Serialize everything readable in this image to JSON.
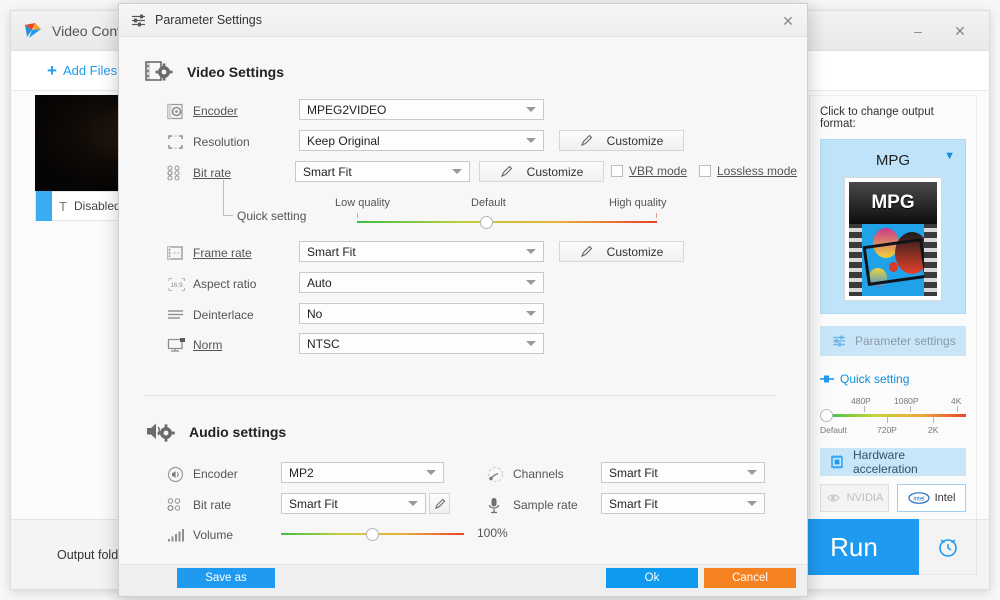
{
  "background_app": {
    "title": "Video Conve",
    "logo_icon": "app-logo-icon",
    "minimize_label": "–",
    "close_label": "✕",
    "toolbar": {
      "add_files_label": "Add Files",
      "plus_icon": "plus-icon"
    },
    "subtitle_row": {
      "icon": "text-subtitle-icon",
      "label": "Disabled"
    },
    "output": {
      "label": "Output folder:"
    },
    "format_panel": {
      "hint": "Click to change output format:",
      "format_name": "MPG",
      "caret_icon": "chevron-down-icon",
      "thumb_label": "MPG",
      "parameter_settings_label": "Parameter settings",
      "parameter_settings_icon": "sliders-icon",
      "quick_setting_label": "Quick setting",
      "quick_setting_icon": "slider-handle-icon",
      "quick_ticks_top": [
        "480P",
        "1080P",
        "4K"
      ],
      "quick_ticks_bottom": [
        "Default",
        "720P",
        "2K"
      ],
      "hardware_acceleration_label": "Hardware acceleration",
      "hardware_acceleration_icon": "chip-icon",
      "gpu_options": [
        {
          "name": "NVIDIA",
          "icon": "nvidia-icon",
          "enabled": false
        },
        {
          "name": "Intel",
          "icon": "intel-icon",
          "enabled": true
        }
      ]
    },
    "run_button_label": "Run",
    "schedule_icon": "alarm-clock-icon"
  },
  "dialog": {
    "title": "Parameter Settings",
    "title_icon": "sliders-icon",
    "close_icon": "close-icon",
    "video": {
      "section_title": "Video Settings",
      "section_icon": "film-gear-icon",
      "rows": [
        {
          "icon": "film-gear-small-icon",
          "label": "Encoder",
          "underline": true,
          "value": "MPEG2VIDEO"
        },
        {
          "icon": "crop-frame-icon",
          "label": "Resolution",
          "underline": false,
          "value": "Keep Original"
        },
        {
          "icon": "bitrate-dots-icon",
          "label": "Bit rate",
          "underline": true,
          "value": "Smart Fit"
        },
        {
          "icon": "frame-rate-icon",
          "label": "Frame rate",
          "underline": true,
          "value": "Smart Fit"
        },
        {
          "icon": "aspect-ratio-icon",
          "label": "Aspect ratio",
          "underline": false,
          "value": "Auto"
        },
        {
          "icon": "deinterlace-icon",
          "label": "Deinterlace",
          "underline": false,
          "value": "No"
        },
        {
          "icon": "monitor-icon",
          "label": "Norm",
          "underline": true,
          "value": "NTSC"
        }
      ],
      "customize_label": "Customize",
      "customize_icon": "pencil-icon",
      "vbr_mode_label": "VBR mode",
      "lossless_mode_label": "Lossless mode",
      "quick_setting_label": "Quick setting",
      "quality_slider": {
        "left_label": "Low quality",
        "center_label": "Default",
        "right_label": "High quality",
        "position_percent": 50
      }
    },
    "audio": {
      "section_title": "Audio settings",
      "section_icon": "speaker-gear-icon",
      "rows_left": [
        {
          "icon": "speaker-icon",
          "label": "Encoder",
          "value": "MP2"
        },
        {
          "icon": "bitrate-dots-icon",
          "label": "Bit rate",
          "value": "Smart Fit"
        }
      ],
      "rows_right": [
        {
          "icon": "channels-icon",
          "label": "Channels",
          "value": "Smart Fit"
        },
        {
          "icon": "microphone-icon",
          "label": "Sample rate",
          "value": "Smart Fit"
        }
      ],
      "edit_icon": "pencil-icon",
      "volume": {
        "label": "Volume",
        "icon": "volume-bars-icon",
        "value": "100%",
        "position_percent": 50
      }
    },
    "footer": {
      "save_as_label": "Save as",
      "ok_label": "Ok",
      "cancel_label": "Cancel"
    }
  },
  "colors": {
    "accent_blue": "#1e9bf0",
    "cancel_orange": "#f58220",
    "panel_blue": "#bfe4fa"
  }
}
